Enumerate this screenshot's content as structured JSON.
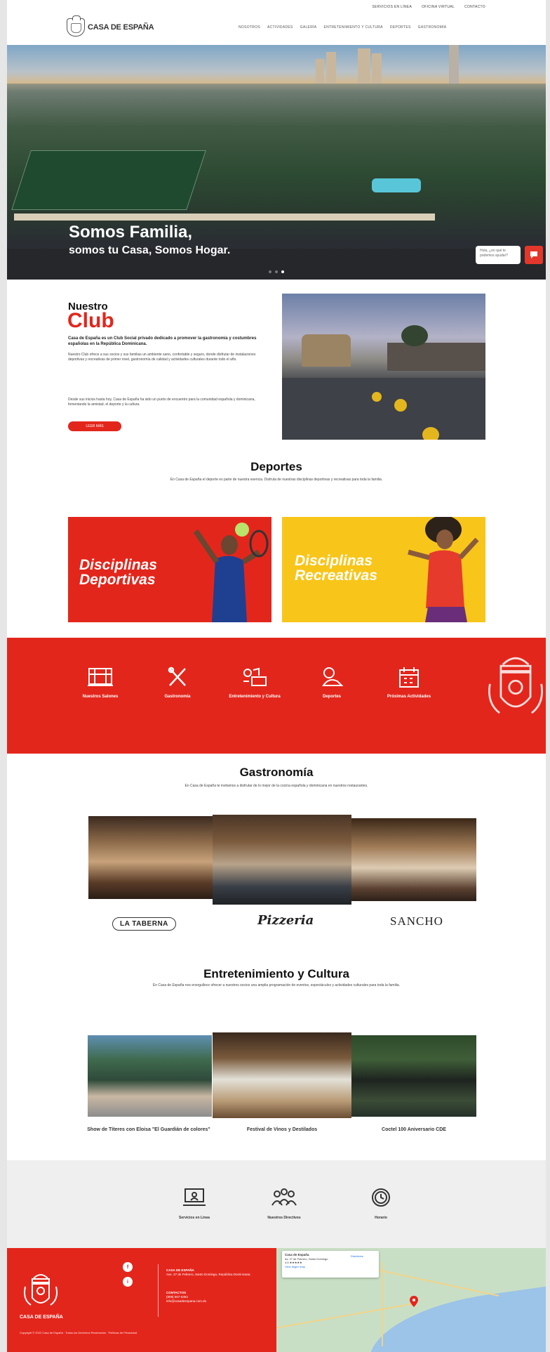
{
  "colors": {
    "brand_red": "#e3261c",
    "brand_yellow": "#f8c51a",
    "footer_bg": "#e3261c",
    "services_bg": "#efefef"
  },
  "topbar": {
    "links": [
      "Servicios en Línea",
      "Oficina Virtual",
      "Contacto"
    ]
  },
  "header": {
    "logo_text": "CASA DE ESPAÑA",
    "logo_icon": "crest-icon",
    "nav": [
      "Nosotros",
      "Actividades",
      "Galería",
      "Entretenimiento y Cultura",
      "Deportes",
      "Gastronomía"
    ]
  },
  "hero": {
    "title": "Somos Familia,",
    "subtitle": "somos tu Casa, Somos Hogar.",
    "slides": 3,
    "active_slide": 3,
    "chat_text": "Hola, ¿en qué te podemos ayudar?",
    "chat_icon": "chat-icon"
  },
  "club": {
    "title_small": "Nuestro",
    "title_big": "Club",
    "lead": "Casa de España es un Club Social privado dedicado a promover la gastronomía y costumbres españolas en la República Dominicana.",
    "paragraphs": [
      "Nuestro Club ofrece a sus socios y sus familias un ambiente sano, confortable y seguro, donde disfrutar de instalaciones deportivas y recreativas de primer nivel, gastronomía de calidad y actividades culturales durante todo el año.",
      "Desde sus inicios hasta hoy, Casa de España ha sido un punto de encuentro para la comunidad española y dominicana, fomentando la amistad, el deporte y la cultura."
    ],
    "button": "Leer más"
  },
  "deportes": {
    "title": "Deportes",
    "subtitle": "En Casa de España el deporte es parte de nuestra esencia. Disfruta de nuestras disciplinas deportivas y recreativas para toda la familia.",
    "cards": [
      {
        "label_line1": "Disciplinas",
        "label_line2": "Deportivas"
      },
      {
        "label_line1": "Disciplinas",
        "label_line2": "Recreativas"
      }
    ]
  },
  "band": {
    "items": [
      {
        "label": "Nuestros Salones",
        "icon": "venue-icon"
      },
      {
        "label": "Gastronomía",
        "icon": "utensils-icon"
      },
      {
        "label": "Entretenimiento y Cultura",
        "icon": "culture-icon"
      },
      {
        "label": "Deportes",
        "icon": "sports-icon"
      },
      {
        "label": "Próximas Actividades",
        "icon": "calendar-icon"
      }
    ]
  },
  "gastronomia": {
    "title": "Gastronomía",
    "subtitle": "En Casa de España te invitamos a disfrutar de lo mejor de la cocina española y dominicana en nuestros restaurantes.",
    "brands": [
      "LA TABERNA",
      "Pizzeria",
      "SANCHO"
    ]
  },
  "entretenimiento": {
    "title": "Entretenimiento y Cultura",
    "subtitle": "En Casa de España nos enorgullece ofrecer a nuestros socios una amplia programación de eventos, espectáculos y actividades culturales para toda la familia.",
    "events": [
      "Show de Títeres con Eloisa \"El Guardián de colores\"",
      "Festival de Vinos y Destilados",
      "Coctel 100 Aniversario CDE"
    ]
  },
  "services": {
    "items": [
      {
        "label": "Servicios en Línea",
        "icon": "laptop-icon"
      },
      {
        "label": "Nuestros Directivos",
        "icon": "directors-icon"
      },
      {
        "label": "Horario",
        "icon": "clock-icon"
      }
    ]
  },
  "footer": {
    "brand": "CASA DE ESPAÑA",
    "social": [
      "f",
      "i"
    ],
    "address_title": "CASA DE ESPAÑA",
    "address": "Ave. 27 de Febrero, Santo Domingo, República Dominicana",
    "contact_title": "CONTACTOS",
    "phone": "(809) 567-5353",
    "email": "info@casadeespana.com.do",
    "copyright": "Copyright © 2022 Casa de España · Todos los Derechos Reservados · Políticas de Privacidad"
  },
  "map": {
    "place": "Casa de España",
    "address": "Av. 27 de Febrero, Santo Domingo",
    "rating": "4.6 ★★★★★",
    "link": "View larger map",
    "directions": "Directions"
  }
}
